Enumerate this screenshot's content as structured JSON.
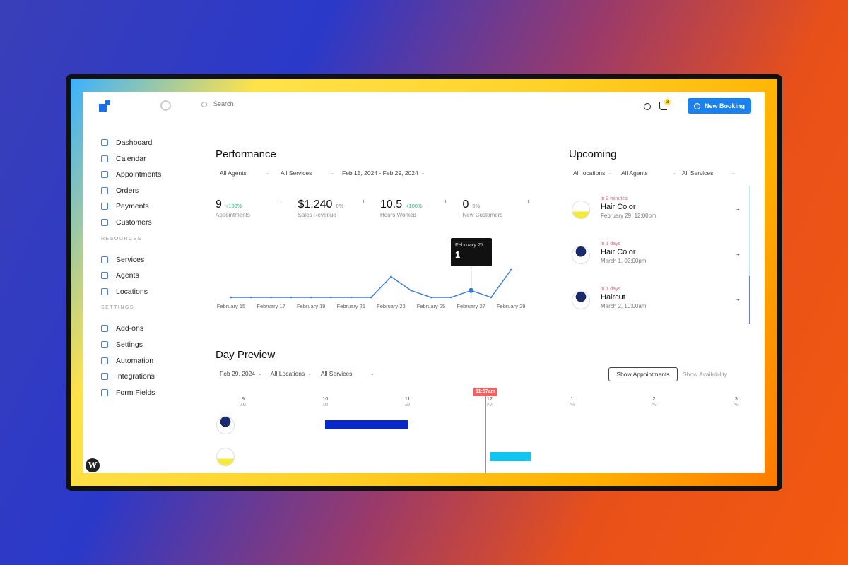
{
  "header": {
    "search_placeholder": "Search",
    "notifications_count": "3",
    "new_booking_label": "New Booking"
  },
  "sidebar": {
    "items": [
      {
        "label": "Dashboard"
      },
      {
        "label": "Calendar"
      },
      {
        "label": "Appointments"
      },
      {
        "label": "Orders"
      },
      {
        "label": "Payments"
      },
      {
        "label": "Customers"
      }
    ],
    "resources_heading": "RESOURCES",
    "resources": [
      {
        "label": "Services"
      },
      {
        "label": "Agents"
      },
      {
        "label": "Locations"
      }
    ],
    "settings_heading": "SETTINGS",
    "settings": [
      {
        "label": "Add-ons"
      },
      {
        "label": "Settings"
      },
      {
        "label": "Automation"
      },
      {
        "label": "Integrations"
      },
      {
        "label": "Form Fields"
      }
    ]
  },
  "performance": {
    "title": "Performance",
    "filters": {
      "agents": "All Agents",
      "services": "All Services",
      "date_range": "Feb 15, 2024 - Feb 29, 2024"
    },
    "kpis": [
      {
        "value": "9",
        "change": "+100%",
        "change_color": "#2bb673",
        "label": "Appointments"
      },
      {
        "value": "$1,240",
        "change": "0%",
        "change_color": "#888888",
        "label": "Sales Revenue"
      },
      {
        "value": "10.5",
        "change": "+100%",
        "change_color": "#2bb673",
        "label": "Hours Worked"
      },
      {
        "value": "0",
        "change": "0%",
        "change_color": "#888888",
        "label": "New Customers"
      }
    ],
    "tooltip": {
      "label": "February 27",
      "value": "1"
    }
  },
  "chart_data": {
    "type": "line",
    "x": [
      "February 15",
      "February 16",
      "February 17",
      "February 18",
      "February 19",
      "February 20",
      "February 21",
      "February 22",
      "February 23",
      "February 24",
      "February 25",
      "February 26",
      "February 27",
      "February 28",
      "February 29"
    ],
    "tick_labels": [
      "February 15",
      "February 17",
      "February 19",
      "February 21",
      "February 23",
      "February 25",
      "February 27",
      "February 29"
    ],
    "values": [
      0,
      0,
      0,
      0,
      0,
      0,
      0,
      0,
      3,
      1,
      0,
      0,
      1,
      0,
      4
    ],
    "color": "#3a7bd5",
    "grid": false,
    "ylim": [
      0,
      4
    ]
  },
  "upcoming": {
    "title": "Upcoming",
    "filters": {
      "locations": "All locations",
      "agents": "All Agents",
      "services": "All Services"
    },
    "items": [
      {
        "when": "in 2 minutes",
        "service": "Hair Color",
        "date": "February 29, 12:00pm"
      },
      {
        "when": "in 1 days",
        "service": "Hair Color",
        "date": "March 1, 02:00pm"
      },
      {
        "when": "in 1 days",
        "service": "Haircut",
        "date": "March 2, 10:00am"
      }
    ]
  },
  "day_preview": {
    "title": "Day Preview",
    "filters": {
      "date": "Feb 29, 2024",
      "locations": "All Locations",
      "services": "All Services"
    },
    "show_appointments": "Show Appointments",
    "show_availability": "Show Availability",
    "now_label": "11:57am",
    "hours": [
      {
        "h": "9",
        "p": "AM"
      },
      {
        "h": "10",
        "p": "AM"
      },
      {
        "h": "11",
        "p": "AM"
      },
      {
        "h": "12",
        "p": "PM"
      },
      {
        "h": "1",
        "p": "PM"
      },
      {
        "h": "2",
        "p": "PM"
      },
      {
        "h": "3",
        "p": "PM"
      }
    ],
    "bookings": [
      {
        "start": "10:00",
        "end": "11:00",
        "color": "#0a28c8"
      },
      {
        "start": "12:00",
        "end": "12:30",
        "color": "#12c4f0"
      }
    ]
  }
}
